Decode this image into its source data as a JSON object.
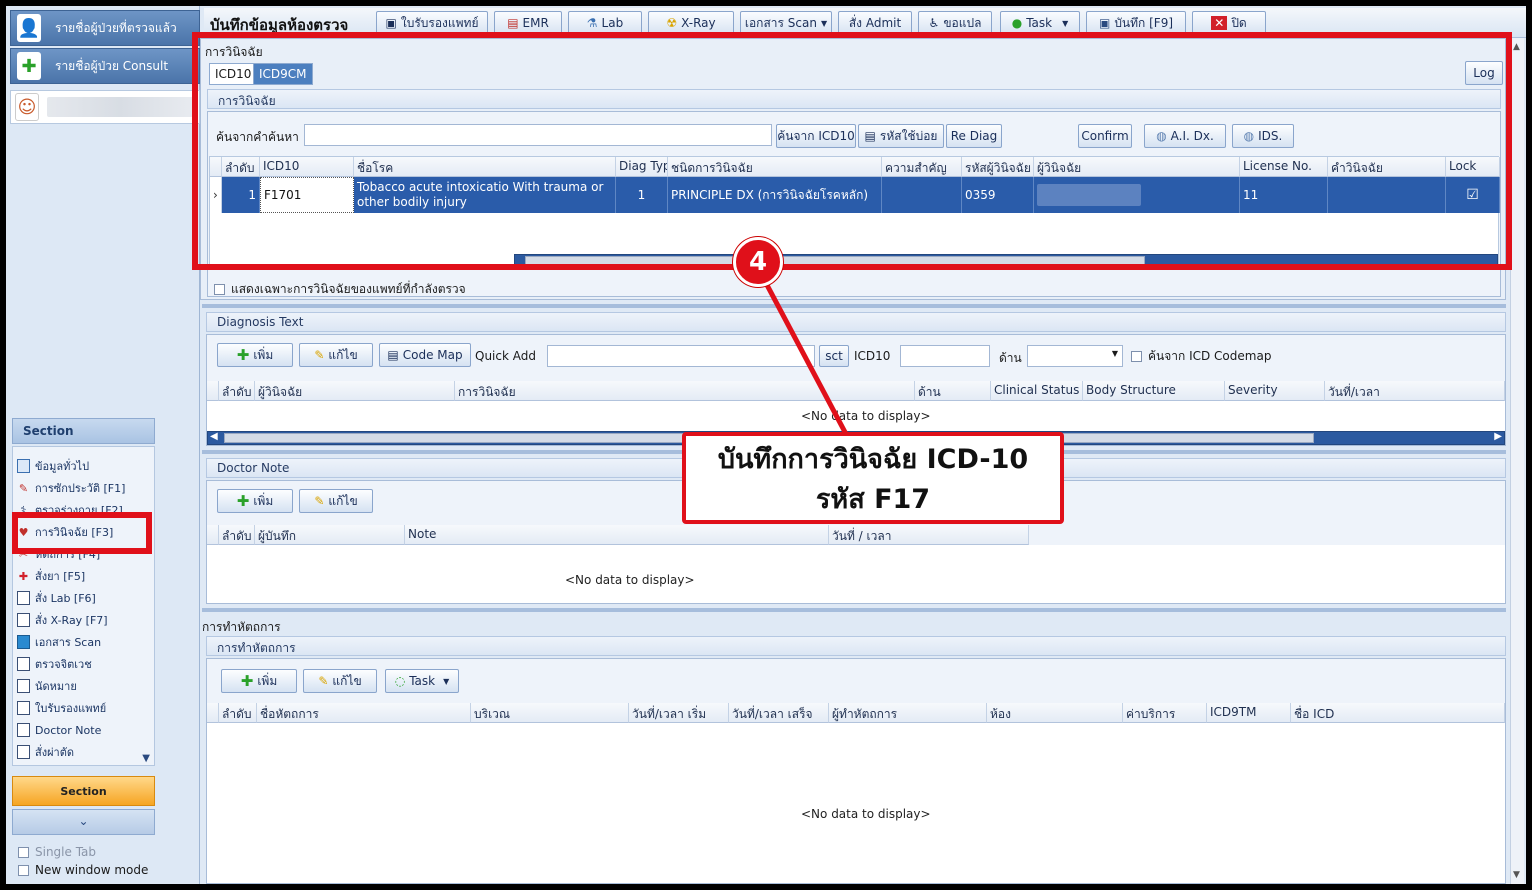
{
  "left_nav": {
    "checked_patients": "รายชื่อผู้ป่วยที่ตรวจแล้ว",
    "consult_patients": "รายชื่อผู้ป่วย Consult"
  },
  "section": {
    "header": "Section",
    "items": [
      {
        "label": "ข้อมูลทั่วไป",
        "icon": "form-icon"
      },
      {
        "label": "การซักประวัติ [F1]",
        "icon": "history-icon"
      },
      {
        "label": "ตรวจร่างกาย [F2]",
        "icon": "exam-icon"
      },
      {
        "label": "การวินิจฉัย [F3]",
        "icon": "diagnosis-icon"
      },
      {
        "label": "หัตถการ [F4]",
        "icon": "procedure-icon"
      },
      {
        "label": "สั่งยา [F5]",
        "icon": "medicine-icon"
      },
      {
        "label": "สั่ง Lab  [F6]",
        "icon": "document-icon"
      },
      {
        "label": "สั่ง X-Ray  [F7]",
        "icon": "document-icon"
      },
      {
        "label": "เอกสาร Scan",
        "icon": "scan-icon"
      },
      {
        "label": "ตรวจจิตเวช",
        "icon": "document-icon"
      },
      {
        "label": "นัดหมาย",
        "icon": "document-icon"
      },
      {
        "label": "ใบรับรองแพทย์",
        "icon": "document-icon"
      },
      {
        "label": "Doctor Note",
        "icon": "document-icon"
      },
      {
        "label": "สั่งผ่าตัด",
        "icon": "document-icon"
      }
    ],
    "footer_label": "Section",
    "single_tab": "Single Tab",
    "new_window": "New window mode"
  },
  "toolbar": {
    "title": "บันทึกข้อมูลห้องตรวจ",
    "buttons": {
      "certificate": "ใบรับรองแพทย์",
      "emr": "EMR",
      "lab": "Lab",
      "xray": "X-Ray",
      "scan": "เอกสาร Scan",
      "admit": "สั่ง Admit",
      "refer": "ขอแปล",
      "task": "Task",
      "save": "บันทึก [F9]",
      "close": "ปิด"
    }
  },
  "diagnosis": {
    "group_title": "การวินิจฉัย",
    "tabs": [
      "ICD10",
      "ICD9CM"
    ],
    "log": "Log",
    "inner_title": "การวินิจฉัย",
    "search_label": "ค้นจากคำค้นหา",
    "search_value": "",
    "btn_search_icd10": "ค้นจาก ICD10",
    "btn_frequent": "รหัสใช้บ่อย",
    "btn_rediag": "Re Diag",
    "btn_confirm": "Confirm",
    "btn_ai": "A.I. Dx.",
    "btn_ids": "IDS.",
    "columns": [
      "ลำดับ",
      "ICD10",
      "ชื่อโรค",
      "Diag Type",
      "ชนิดการวินิจฉัย",
      "ความสำคัญ",
      "รหัสผู้วินิจฉัย",
      "ผู้วินิจฉัย",
      "License No.",
      "คำวินิจฉัย",
      "Lock"
    ],
    "rows": [
      {
        "no": "1",
        "icd10": "F1701",
        "name": "Tobacco acute intoxicatio With trauma or other bodily injury",
        "diag_type": "1",
        "kind": "PRINCIPLE DX (การวินิจฉัยโรคหลัก)",
        "priority": "",
        "doctor_code": "0359",
        "doctor": "",
        "license": "11",
        "remark": "",
        "lock": "☑"
      }
    ],
    "only_mine": "แสดงเฉพาะการวินิจฉัยของแพทย์ที่กำลังตรวจ"
  },
  "diagnosis_text": {
    "title": "Diagnosis Text",
    "btn_add": "เพิ่ม",
    "btn_edit": "แก้ไข",
    "btn_codemap": "Code Map",
    "quick_add_label": "Quick Add",
    "btn_sct": "sct",
    "icd10_label": "ICD10",
    "side_label": "ด้าน",
    "codemap_search": "ค้นจาก ICD Codemap",
    "columns": [
      "ลำดับ",
      "ผู้วินิจฉัย",
      "การวินิจฉัย",
      "ด้าน",
      "Clinical Status",
      "Body Structure",
      "Severity",
      "วันที่/เวลา"
    ],
    "nodata": "<No data to display>"
  },
  "doctor_note": {
    "title": "Doctor Note",
    "btn_add": "เพิ่ม",
    "btn_edit": "แก้ไข",
    "columns": [
      "ลำดับ",
      "ผู้บันทึก",
      "Note",
      "วันที่ / เวลา"
    ],
    "nodata": "<No data to display>"
  },
  "procedure": {
    "group_title": "การทำหัตถการ",
    "inner_title": "การทำหัตถการ",
    "btn_add": "เพิ่ม",
    "btn_edit": "แก้ไข",
    "btn_task": "Task",
    "columns": [
      "ลำดับ",
      "ชื่อหัตถการ",
      "บริเวณ",
      "วันที่/เวลา เริ่ม",
      "วันที่/เวลา เสร็จ",
      "ผู้ทำหัตถการ",
      "ห้อง",
      "ค่าบริการ",
      "ICD9TM",
      "ชื่อ ICD"
    ],
    "nodata": "<No data to display>"
  },
  "annotation": {
    "step": "4",
    "line1": "บันทึกการวินิจฉัย ICD-10",
    "line2": "รหัส F17",
    "color": "#e0101a"
  }
}
